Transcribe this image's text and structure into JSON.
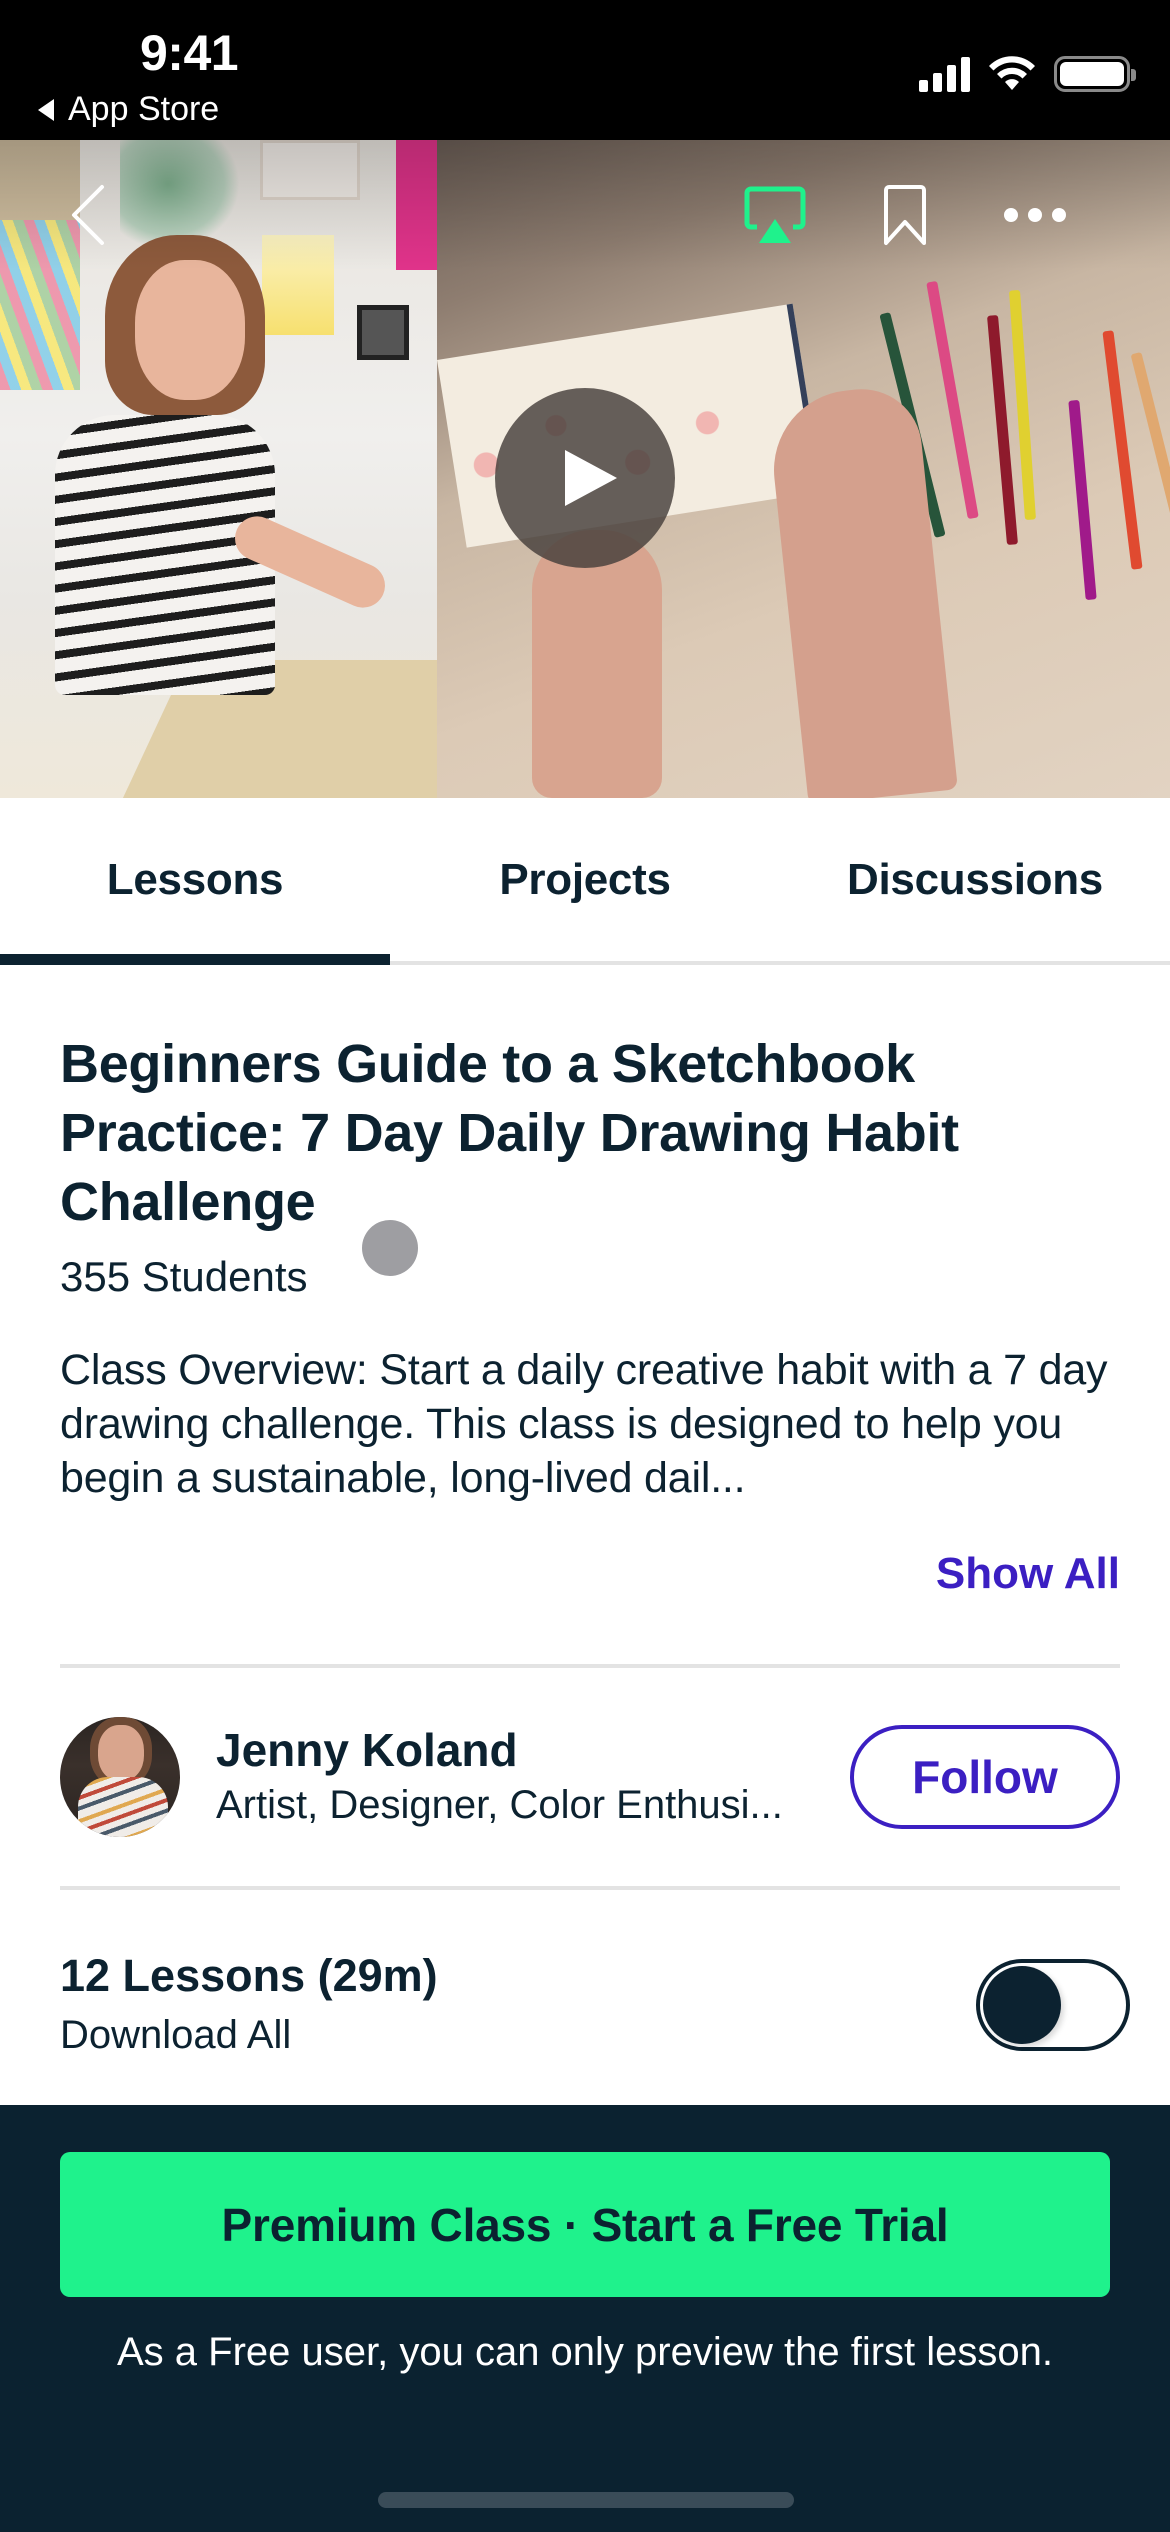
{
  "status_bar": {
    "time": "9:41",
    "back_app": "App Store",
    "icons": [
      "cellular-signal",
      "wifi",
      "battery"
    ]
  },
  "hero": {
    "back_icon": "chevron-left",
    "actions": [
      {
        "name": "airplay",
        "color": "#1ff28c"
      },
      {
        "name": "bookmark",
        "color": "#ffffff"
      },
      {
        "name": "more-horizontal",
        "color": "#ffffff"
      }
    ],
    "play_icon": "play"
  },
  "tabs": [
    {
      "label": "Lessons",
      "active": true
    },
    {
      "label": "Projects",
      "active": false
    },
    {
      "label": "Discussions",
      "active": false
    }
  ],
  "class": {
    "title": "Beginners Guide to a Sketchbook Practice: 7 Day Daily Drawing Habit Challenge",
    "students": "355 Students",
    "overview": "Class Overview:  Start a daily creative habit with a 7 day drawing challenge. This class is designed to help you begin a sustainable, long-lived dail...",
    "show_all": "Show All"
  },
  "instructor": {
    "name": "Jenny Koland",
    "bio": "Artist, Designer, Color Enthusi...",
    "follow_label": "Follow"
  },
  "lessons": {
    "count_label": "12 Lessons (29m)",
    "download_label": "Download All",
    "download_enabled": false
  },
  "cta": {
    "button_label": "Premium Class · Start a Free Trial",
    "note": "As a Free user, you can only preview the first lesson."
  },
  "colors": {
    "brand_green": "#1ff28c",
    "link_purple": "#3b1fc2",
    "navy": "#0b2230"
  }
}
